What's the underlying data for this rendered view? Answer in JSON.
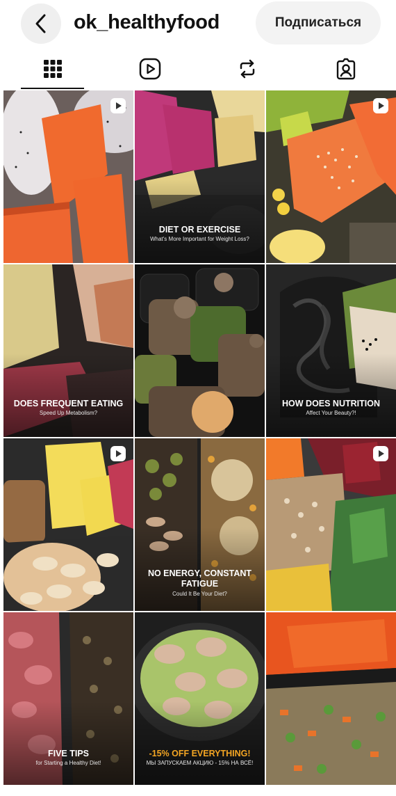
{
  "header": {
    "username": "ok_healthyfood",
    "follow_label": "Подписаться"
  },
  "tabs": [
    {
      "name": "posts",
      "icon": "grid-icon",
      "active": true
    },
    {
      "name": "reels",
      "icon": "reels-icon",
      "active": false
    },
    {
      "name": "reposts",
      "icon": "repost-icon",
      "active": false
    },
    {
      "name": "tagged",
      "icon": "tagged-icon",
      "active": false
    }
  ],
  "posts": [
    {
      "type": "reel",
      "title": "",
      "subtitle": ""
    },
    {
      "type": "post",
      "title": "DIET OR EXERCISE",
      "subtitle": "What's More Important for Weight Loss?"
    },
    {
      "type": "reel",
      "title": "",
      "subtitle": ""
    },
    {
      "type": "post",
      "title": "DOES FREQUENT EATING",
      "subtitle": "Speed Up Metabolism?"
    },
    {
      "type": "post",
      "title": "",
      "subtitle": ""
    },
    {
      "type": "post",
      "title": "HOW DOES NUTRITION",
      "subtitle": "Affect Your Beauty?!"
    },
    {
      "type": "reel",
      "title": "",
      "subtitle": ""
    },
    {
      "type": "post",
      "title": "NO ENERGY, CONSTANT FATIGUE",
      "subtitle": "Could It Be Your Diet?"
    },
    {
      "type": "reel",
      "title": "",
      "subtitle": ""
    },
    {
      "type": "post",
      "title": "FIVE TIPS",
      "subtitle": "for Starting a Healthy Diet!"
    },
    {
      "type": "post",
      "title": "-15% OFF EVERYTHING!",
      "subtitle": "МЫ ЗАПУСКАЕМ АКЦИЮ - 15% НА ВСЁ!"
    },
    {
      "type": "post",
      "title": "",
      "subtitle": ""
    }
  ],
  "colors": {
    "accent": "#f5a623",
    "button_bg": "#f3f3f3"
  }
}
